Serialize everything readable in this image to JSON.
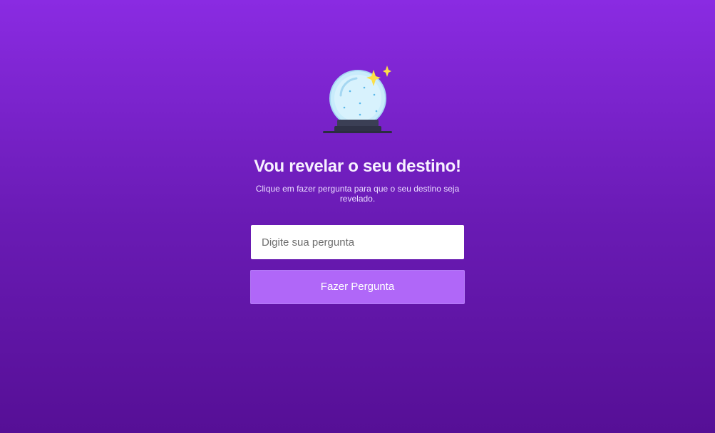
{
  "header": {
    "icon": "crystal-ball-icon",
    "title": "Vou revelar o seu destino!",
    "subtitle": "Clique em fazer pergunta para que o seu destino seja revelado."
  },
  "form": {
    "question_placeholder": "Digite sua pergunta",
    "question_value": "",
    "submit_label": "Fazer Pergunta"
  },
  "colors": {
    "background_top": "#8a2be2",
    "background_bottom": "#560f96",
    "button": "#b067f8",
    "sparkle": "#fde047"
  }
}
